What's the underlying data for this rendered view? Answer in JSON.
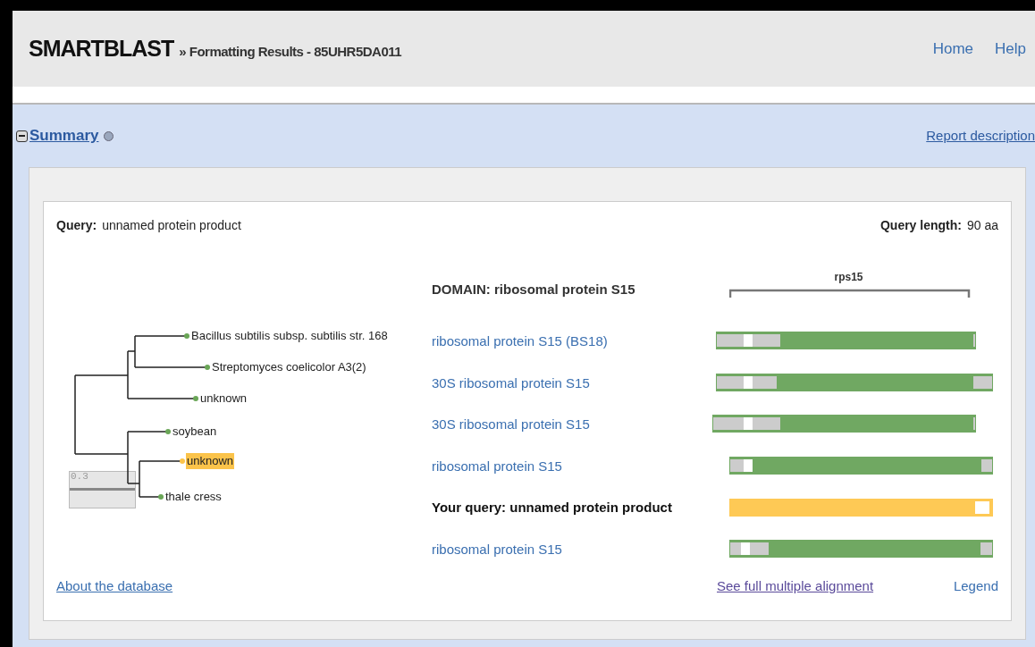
{
  "header": {
    "brand": "SMARTBLAST",
    "breadcrumb": "» Formatting Results - 85UHR5DA011",
    "links": [
      "Home",
      "Help"
    ]
  },
  "section": {
    "title": "Summary",
    "expanded": true,
    "report_link": "Report description"
  },
  "query": {
    "label": "Query:",
    "value": "unnamed protein product",
    "length_label": "Query length:",
    "length_value": "90 aa"
  },
  "tree": {
    "scale": "0.3",
    "leaves": [
      {
        "label": "Bacillus subtilis subsp. subtilis str. 168",
        "color": "#6aa657",
        "selected": false
      },
      {
        "label": "Streptomyces coelicolor A3(2)",
        "color": "#6aa657",
        "selected": false
      },
      {
        "label": "unknown",
        "color": "#6aa657",
        "selected": false
      },
      {
        "label": "soybean",
        "color": "#6aa657",
        "selected": false
      },
      {
        "label": "unknown",
        "color": "#fbc34a",
        "selected": true
      },
      {
        "label": "thale cress",
        "color": "#6aa657",
        "selected": false
      }
    ]
  },
  "domain": {
    "heading": "DOMAIN: ribosomal protein S15",
    "name": "rps15"
  },
  "hits": [
    {
      "label": "ribosomal protein S15 (BS18)",
      "kind": "hit"
    },
    {
      "label": "30S ribosomal protein S15",
      "kind": "hit"
    },
    {
      "label": "30S ribosomal protein S15",
      "kind": "hit"
    },
    {
      "label": "ribosomal protein S15",
      "kind": "hit"
    },
    {
      "label": "Your query: unnamed protein product",
      "kind": "query"
    },
    {
      "label": "ribosomal protein S15",
      "kind": "hit"
    }
  ],
  "footer": {
    "about": "About the database",
    "alignment": "See full multiple alignment",
    "legend": "Legend"
  }
}
